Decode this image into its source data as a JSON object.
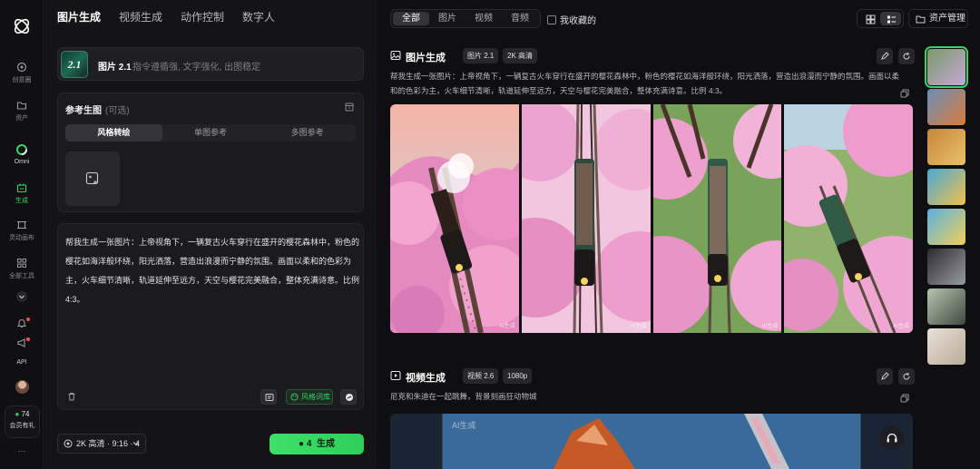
{
  "rail": {
    "items": [
      {
        "label": "创意圈",
        "icon": "sparkle-icon"
      },
      {
        "label": "资产",
        "icon": "folder-icon"
      },
      {
        "label": "Omni",
        "icon": "omni-ring-icon"
      },
      {
        "label": "生成",
        "icon": "generate-icon"
      },
      {
        "label": "灵动画布",
        "icon": "canvas-icon"
      },
      {
        "label": "全部工具",
        "icon": "grid-icon"
      }
    ],
    "api_label": "API",
    "credits": "74",
    "member_label": "会员有礼",
    "more_label": "···"
  },
  "panel": {
    "tabs": [
      "图片生成",
      "视频生成",
      "动作控制",
      "数字人"
    ],
    "active_tab": 0,
    "model": {
      "thumb_text": "2.1",
      "name": "图片 2.1",
      "desc": "指令遵循强, 文字强化, 出图稳定"
    },
    "reference": {
      "title": "参考生图",
      "optional": "(可选)",
      "modes": [
        "风格转绘",
        "单图参考",
        "多图参考"
      ],
      "active_mode": 0
    },
    "prompt": "帮我生成一张图片：上帝视角下，一辆复古火车穿行在盛开的樱花森林中，粉色的樱花如海洋般环绕，阳光洒落，营造出浪漫而宁静的氛围。画面以柔和的色彩为主，火车细节清晰，轨道延伸至远方，天空与樱花完美融合，整体充满诗意。比例 4:3。",
    "style_lib_label": "风格词库",
    "settings_label": "2K 高清 · 9:16 · 4",
    "generate": {
      "count": "4",
      "label": "生成"
    }
  },
  "main": {
    "filters": [
      "全部",
      "图片",
      "视频",
      "音频"
    ],
    "active_filter": 0,
    "favorites_label": "我收藏的",
    "asset_manage_label": "资产管理",
    "image_section": {
      "title": "图片生成",
      "tags": [
        "图片 2.1",
        "2K 高清"
      ],
      "prompt": "帮我生成一张图片：上帝视角下，一辆复古火车穿行在盛开的樱花森林中，粉色的樱花如海洋般环绕，阳光洒落，营造出浪漫而宁静的氛围。画面以柔和的色彩为主，火车细节清晰，轨道延伸至远方，天空与樱花完美融合，整体充满诗意。比例 4:3。",
      "image_count": 4,
      "watermark": "AI生成"
    },
    "video_section": {
      "title": "视频生成",
      "tags": [
        "视频 2.6",
        "1080p"
      ],
      "prompt": "尼克和朱迪在一起跳舞，背景刻画狂动物城",
      "watermark": "AI生成"
    }
  },
  "colors": {
    "accent": "#36d36a",
    "background": "#0f0f11",
    "panel": "#141416",
    "card": "#1b1b1e"
  }
}
